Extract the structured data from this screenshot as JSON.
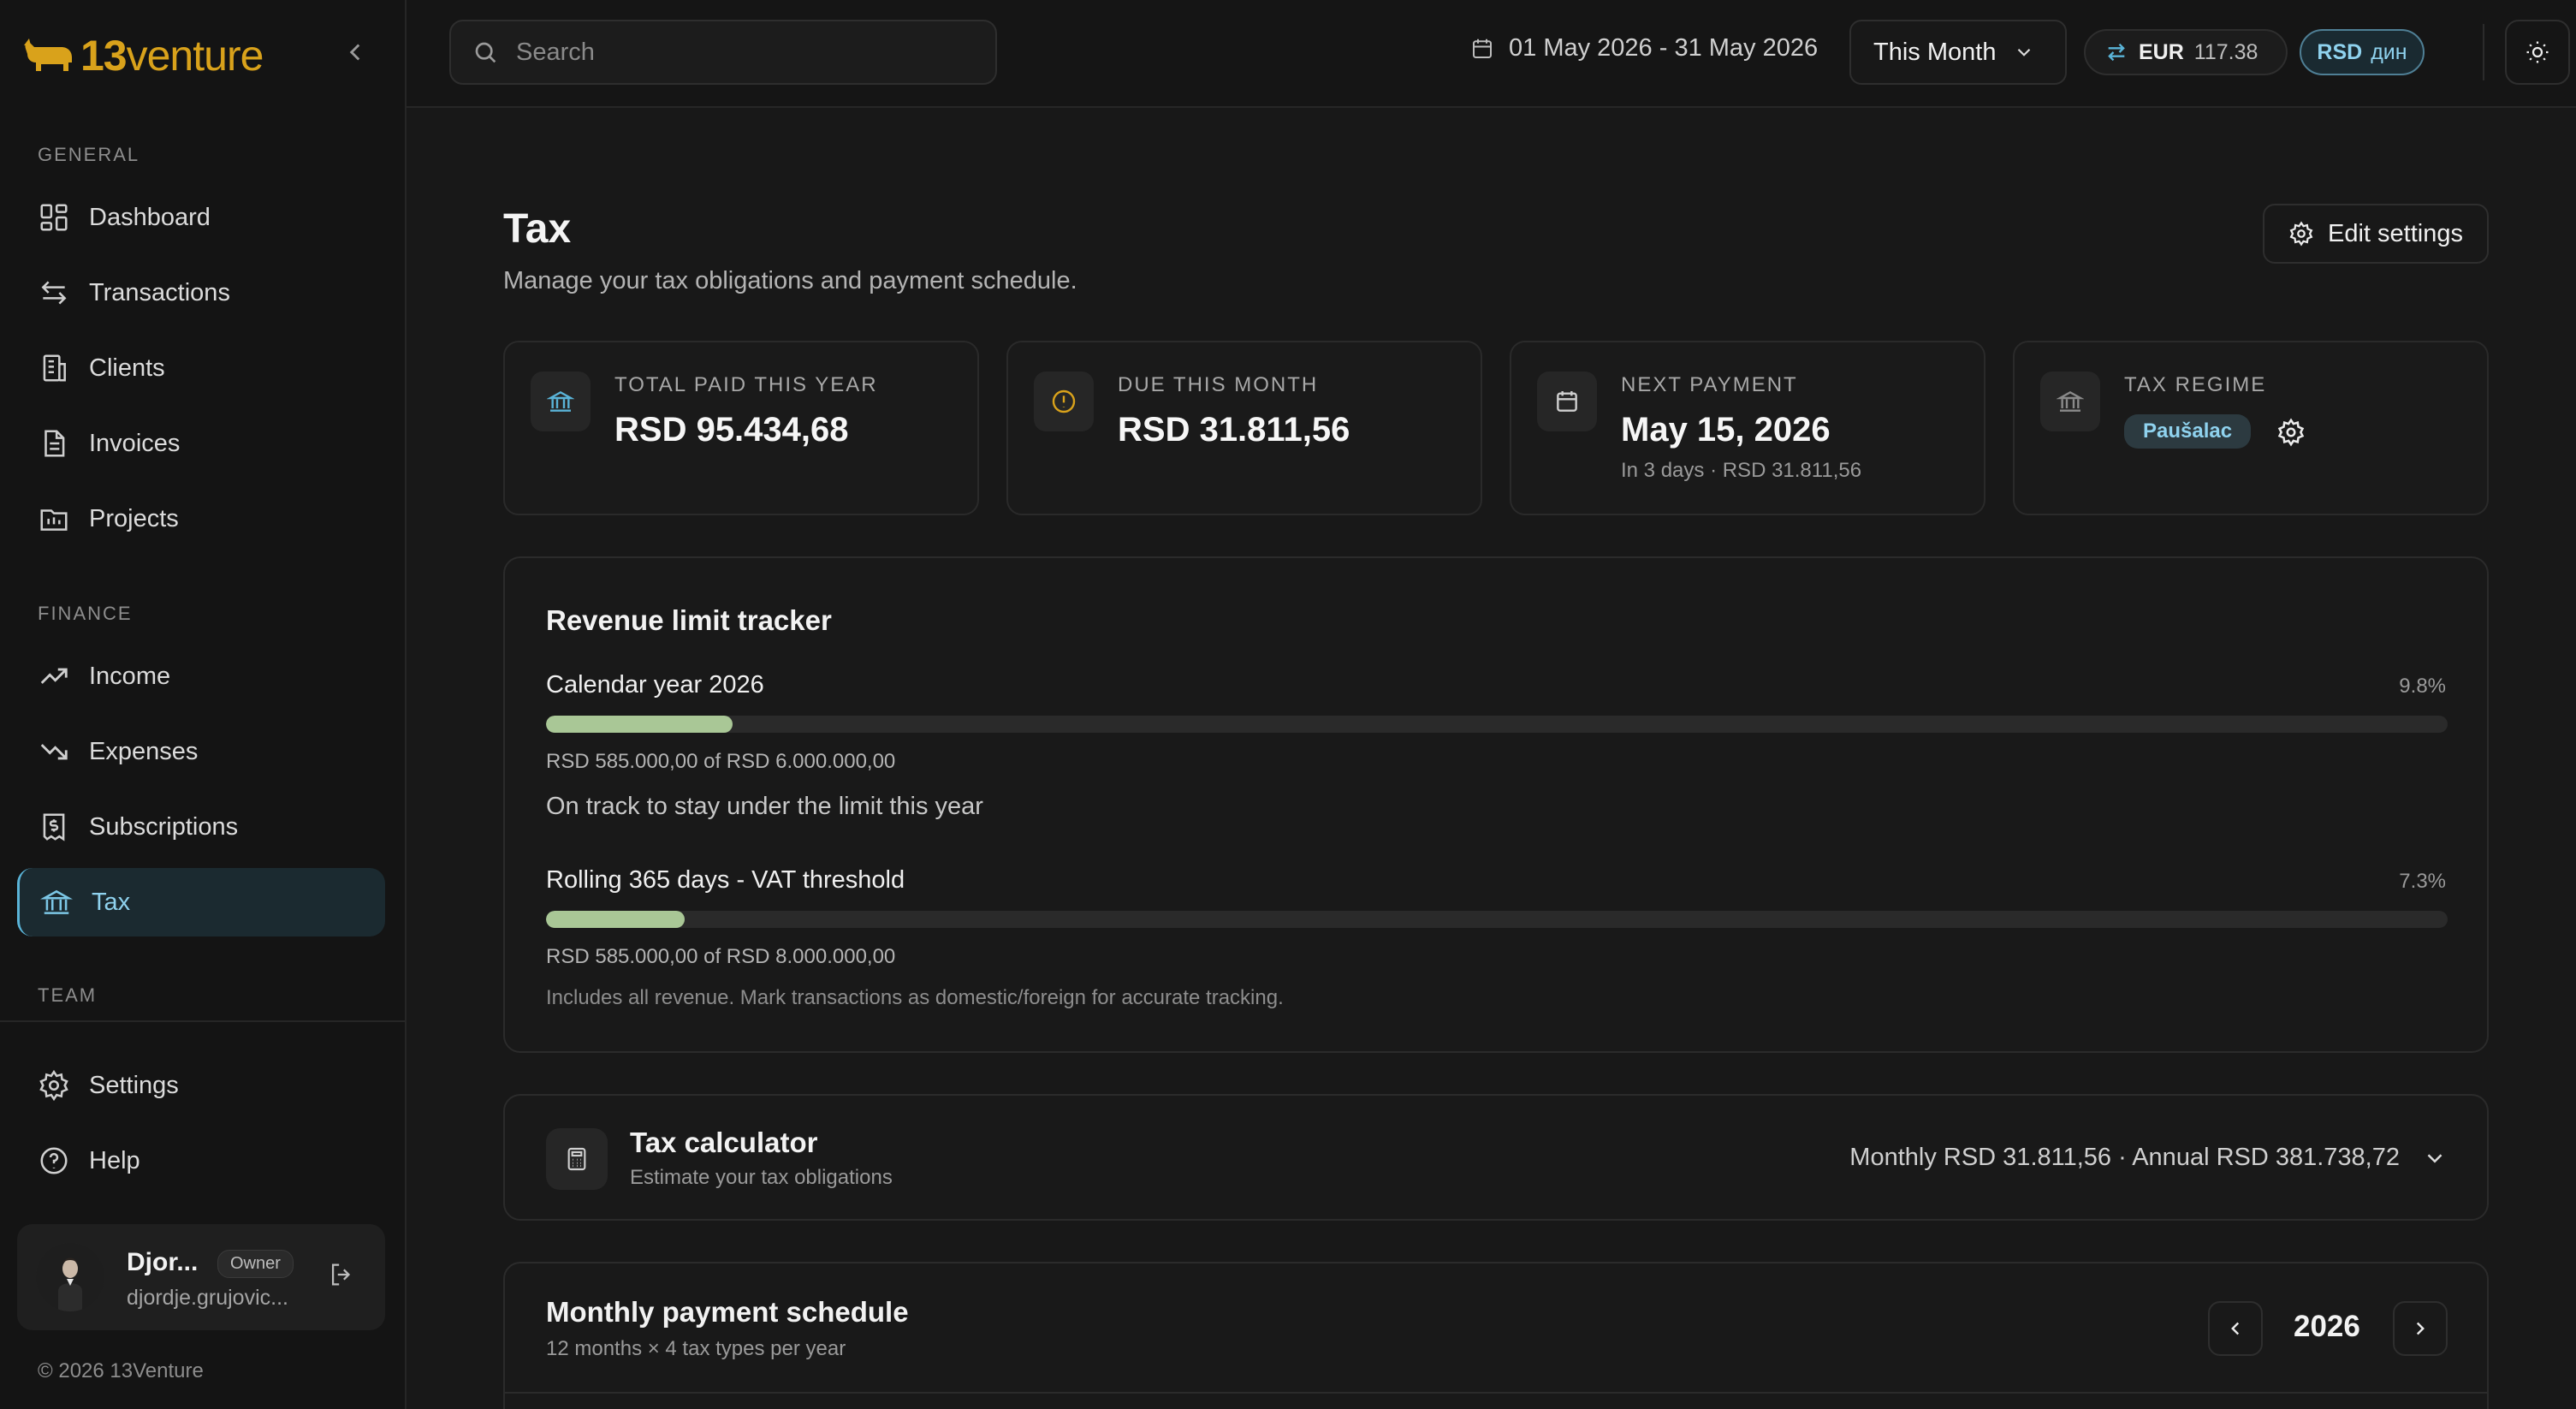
{
  "app": {
    "logo_number": "13",
    "logo_word": "venture",
    "copyright": "© 2026 13Venture"
  },
  "sidebar": {
    "sections": {
      "general": "GENERAL",
      "finance": "FINANCE",
      "team": "TEAM"
    },
    "items": [
      {
        "label": "Dashboard",
        "icon": "dashboard-icon"
      },
      {
        "label": "Transactions",
        "icon": "transactions-icon"
      },
      {
        "label": "Clients",
        "icon": "clients-icon"
      },
      {
        "label": "Invoices",
        "icon": "invoices-icon"
      },
      {
        "label": "Projects",
        "icon": "projects-icon"
      },
      {
        "label": "Income",
        "icon": "income-icon"
      },
      {
        "label": "Expenses",
        "icon": "expenses-icon"
      },
      {
        "label": "Subscriptions",
        "icon": "subscriptions-icon"
      },
      {
        "label": "Tax",
        "icon": "bank-icon",
        "active": true
      },
      {
        "label": "Settings",
        "icon": "gear-icon"
      },
      {
        "label": "Help",
        "icon": "help-icon"
      }
    ],
    "user": {
      "name": "Djor...",
      "role": "Owner",
      "email": "djordje.grujovic..."
    }
  },
  "topbar": {
    "search_placeholder": "Search",
    "date_range": "01 May 2026 - 31 May 2026",
    "period": "This Month",
    "fx": {
      "code": "EUR",
      "rate": "117.38"
    },
    "currency": {
      "code": "RSD",
      "symbol": "дин"
    }
  },
  "page": {
    "title": "Tax",
    "subtitle": "Manage your tax obligations and payment schedule.",
    "edit_label": "Edit settings"
  },
  "stats": [
    {
      "label": "TOTAL PAID THIS YEAR",
      "value": "RSD 95.434,68",
      "icon": "bank-icon"
    },
    {
      "label": "DUE THIS MONTH",
      "value": "RSD 31.811,56",
      "icon": "alert-circle-icon"
    },
    {
      "label": "NEXT PAYMENT",
      "value": "May 15, 2026",
      "sub": "In 3 days · RSD 31.811,56",
      "icon": "calendar-icon"
    },
    {
      "label": "TAX REGIME",
      "badge": "Paušalac",
      "icon": "bank-icon"
    }
  ],
  "tracker": {
    "title": "Revenue limit tracker",
    "calendar": {
      "label": "Calendar year 2026",
      "percent_text": "9.8%",
      "fraction": 0.098,
      "amount": "RSD 585.000,00 of RSD 6.000.000,00",
      "message": "On track to stay under the limit this year"
    },
    "rolling": {
      "label": "Rolling 365 days - VAT threshold",
      "percent_text": "7.3%",
      "fraction": 0.073,
      "amount": "RSD 585.000,00 of RSD 8.000.000,00",
      "note": "Includes all revenue. Mark transactions as domestic/foreign for accurate tracking."
    }
  },
  "calculator": {
    "title": "Tax calculator",
    "subtitle": "Estimate your tax obligations",
    "summary": "Monthly RSD 31.811,56 · Annual RSD 381.738,72"
  },
  "schedule": {
    "title": "Monthly payment schedule",
    "subtitle": "12 months × 4 tax types per year",
    "year": "2026"
  },
  "colors": {
    "accent": "#5ab4d8",
    "brand": "#d9a21b",
    "progress": "#a9c796",
    "background": "#181818"
  }
}
